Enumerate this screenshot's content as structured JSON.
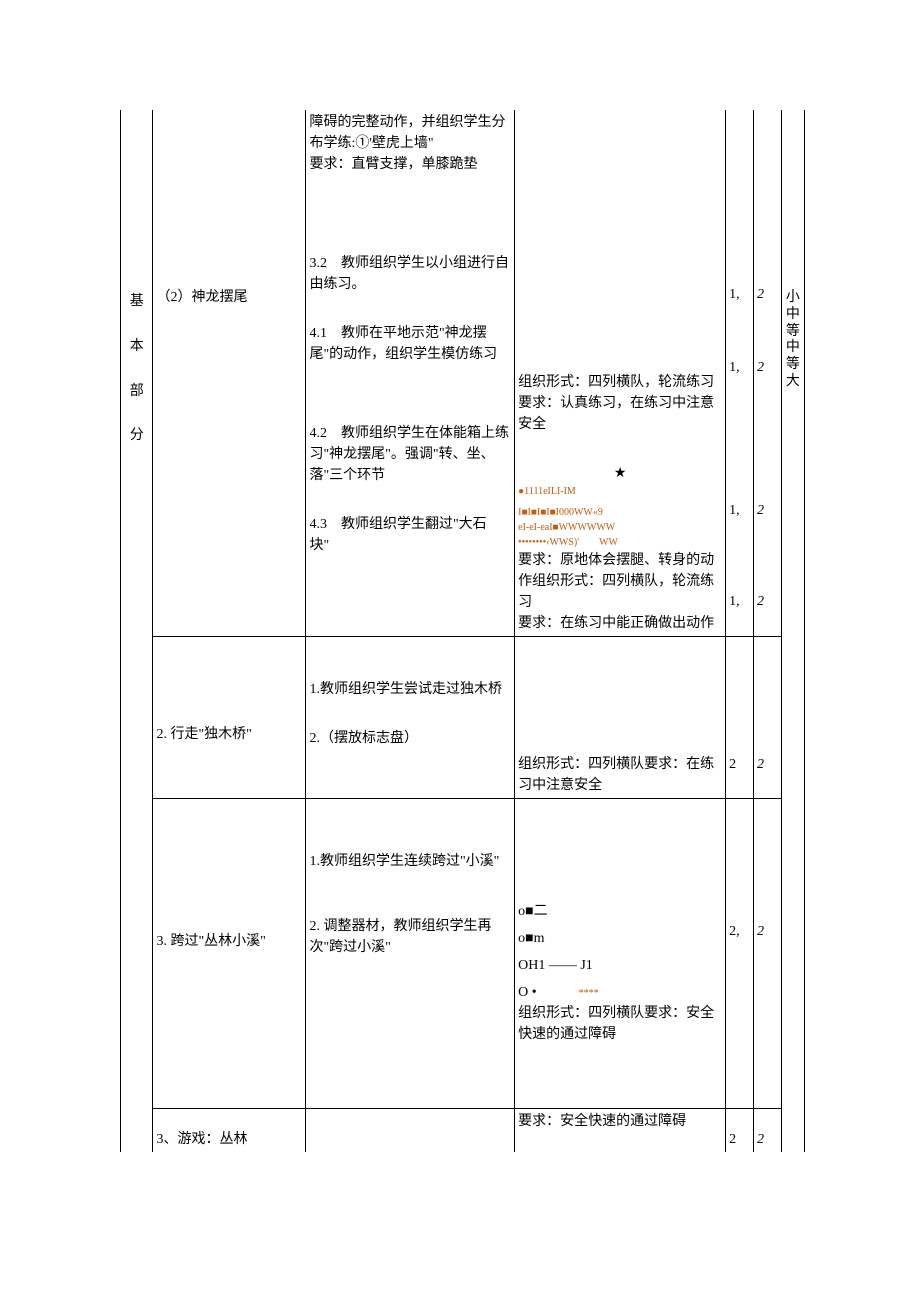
{
  "section_label": [
    "基",
    "本",
    "部",
    "分"
  ],
  "intensity_label": [
    "小",
    "中",
    "等",
    "中",
    "等",
    "大"
  ],
  "rows": [
    {
      "activity": "（2）神龙摆尾",
      "teacher": [
        "障碍的完整动作，并组织学生分布学练:①'壁虎上墙\"\n要求：直臂支撑，单膝跪垫",
        "3.2　教师组织学生以小组进行自由练习。",
        "4.1　教师在平地示范\"神龙摆尾\"的动作，组织学生模仿练习",
        "4.2　教师组织学生在体能箱上练习\"神龙摆尾\"。强调\"转、坐、落\"三个环节",
        "4.3　教师组织学生翻过\"大石　块\""
      ],
      "org": [
        "组织形式：四列横队，轮流练习",
        "要求：认真练习，在练习中注意安全",
        "★",
        "●1111eILI-IM",
        "I■I■I■I■I000WW«9",
        "eI-eI-eaI■WWWWWW",
        "••••••••‹WWS)'　　WW",
        "要求：原地体会摆腿、转身的动作组织形式：四列横队，轮流练习",
        "要求：在练习中能正确做出动作"
      ],
      "n1": [
        "1,",
        "1,",
        "1,",
        "1,"
      ],
      "n2": [
        "2",
        "2",
        "2",
        "2"
      ]
    },
    {
      "activity": "2. 行走\"独木桥\"",
      "teacher": [
        "1.教师组织学生尝试走过独木桥",
        "2.（摆放标志盘）"
      ],
      "org": [
        "组织形式：四列横队要求：在练习中注意安全"
      ],
      "n1": [
        "2"
      ],
      "n2": [
        "2"
      ]
    },
    {
      "activity": "3. 跨过\"丛林小溪\"",
      "teacher": [
        "1.教师组织学生连续跨过\"小溪\"",
        "2. 调整器材，教师组织学生再次\"跨过小溪\""
      ],
      "org": [
        "o■二",
        "o■m",
        "OH1 ―― J1",
        "O •　　　****",
        "组织形式：四列横队要求：安全快速的通过障碍"
      ],
      "n1": [
        "2,"
      ],
      "n2": [
        "2"
      ]
    },
    {
      "activity": "3、游戏：丛林",
      "teacher": [],
      "org": [
        "要求：安全快速的通过障碍"
      ],
      "n1": [
        "2"
      ],
      "n2": [
        "2"
      ]
    }
  ]
}
